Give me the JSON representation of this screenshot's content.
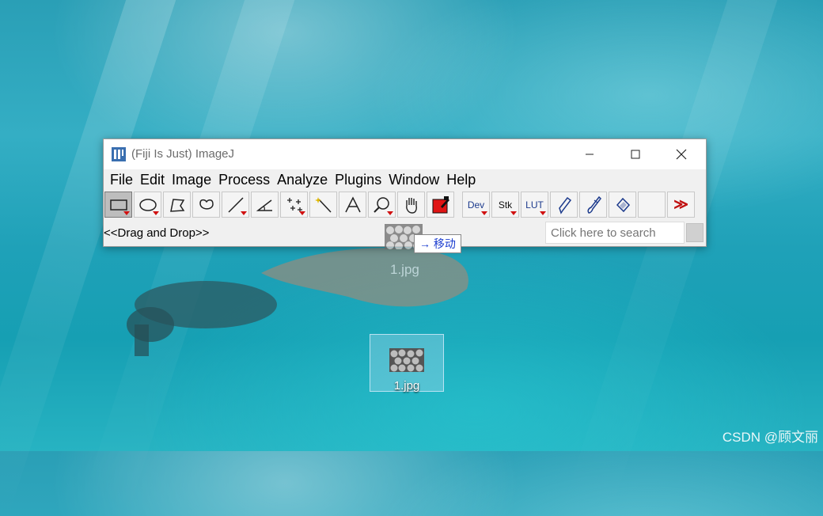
{
  "window": {
    "title": "(Fiji Is Just) ImageJ"
  },
  "menu": [
    "File",
    "Edit",
    "Image",
    "Process",
    "Analyze",
    "Plugins",
    "Window",
    "Help"
  ],
  "toolbar": {
    "dev_label": "Dev",
    "stk_label": "Stk",
    "lut_label": "LUT",
    "more_label": "≫",
    "tools": [
      {
        "name": "rectangle-icon"
      },
      {
        "name": "oval-icon"
      },
      {
        "name": "polygon-icon"
      },
      {
        "name": "freehand-icon"
      },
      {
        "name": "line-icon"
      },
      {
        "name": "angle-icon"
      },
      {
        "name": "point-icon"
      },
      {
        "name": "wand-icon"
      },
      {
        "name": "text-icon"
      },
      {
        "name": "magnifier-icon"
      },
      {
        "name": "hand-icon"
      },
      {
        "name": "color-picker-icon"
      }
    ]
  },
  "status": {
    "text": "<<Drag and Drop>>",
    "search_placeholder": "Click here to search"
  },
  "drag": {
    "tooltip": "→ 移动",
    "ghost_label": "1.jpg"
  },
  "desktop_icon": {
    "label": "1.jpg"
  },
  "watermark": "CSDN @顾文丽"
}
